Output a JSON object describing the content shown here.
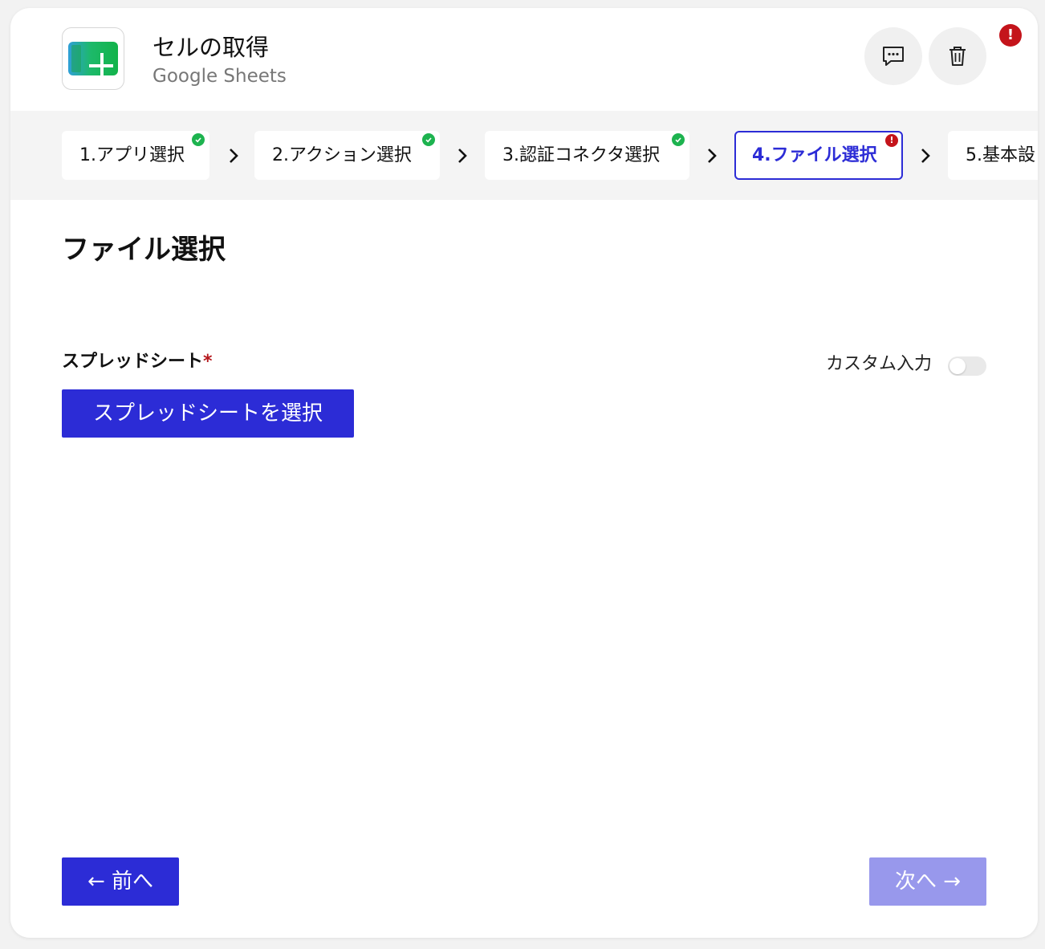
{
  "header": {
    "title": "セルの取得",
    "subtitle": "Google Sheets",
    "app_icon": "google-sheets-icon",
    "alert_mark": "!"
  },
  "steps": [
    {
      "label": "1.アプリ選択",
      "status": "complete"
    },
    {
      "label": "2.アクション選択",
      "status": "complete"
    },
    {
      "label": "3.認証コネクタ選択",
      "status": "complete"
    },
    {
      "label": "4.ファイル選択",
      "status": "error",
      "active": true
    },
    {
      "label": "5.基本設",
      "status": "none"
    }
  ],
  "step_error_mark": "!",
  "main": {
    "section_title": "ファイル選択",
    "field_label": "スプレッドシート",
    "required_mark": "*",
    "custom_input_label": "カスタム入力",
    "custom_input_enabled": false,
    "select_button_label": "スプレッドシートを選択"
  },
  "footer": {
    "prev_label": "← 前へ",
    "next_label": "次へ →",
    "next_enabled": false
  },
  "colors": {
    "primary": "#2c2cd6",
    "primary_disabled": "#9898ec",
    "success": "#1db34f",
    "error": "#c4141b",
    "steps_background": "#f4f4f4"
  }
}
